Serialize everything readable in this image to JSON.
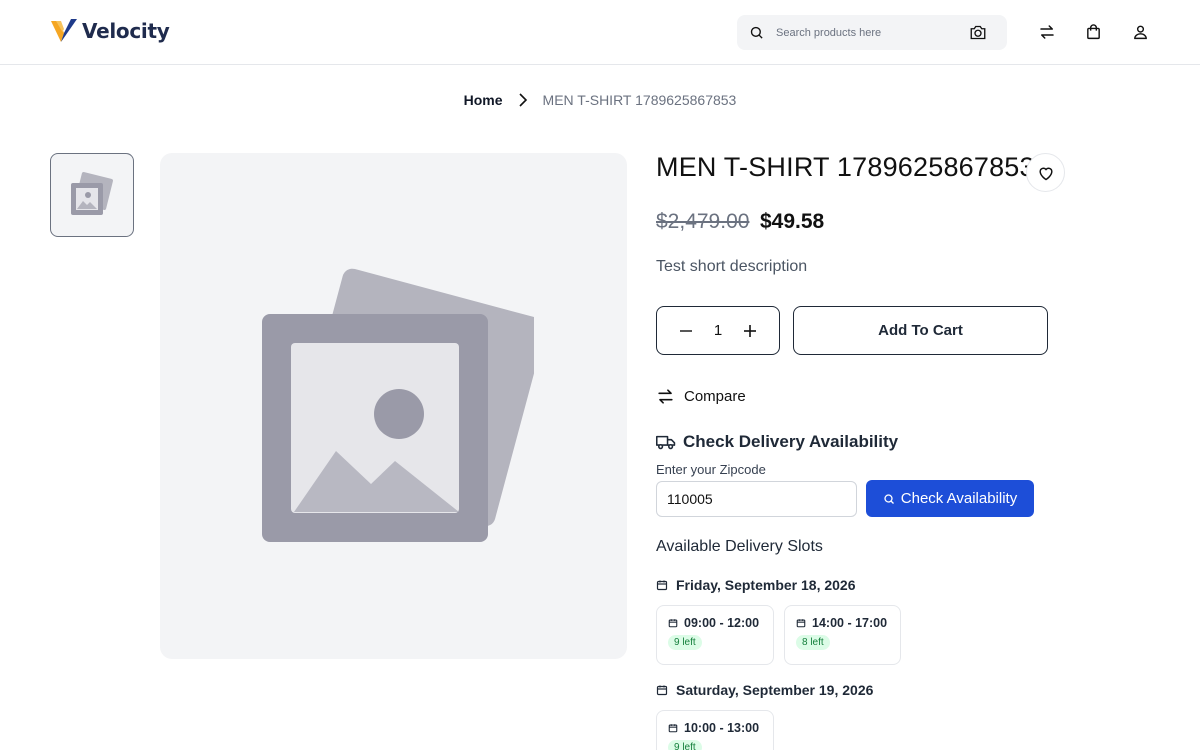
{
  "header": {
    "brand": "Velocity",
    "search_placeholder": "Search products here",
    "icons": [
      "search-icon",
      "camera-icon",
      "compare-icon",
      "shopping-bag-icon",
      "user-icon"
    ]
  },
  "breadcrumb": {
    "home": "Home",
    "current": "MEN T-SHIRT 1789625867853"
  },
  "product": {
    "title": "MEN T-SHIRT 1789625867853",
    "price_old": "$2,479.00",
    "price_new": "$49.58",
    "short_description": "Test short description",
    "quantity": "1",
    "add_to_cart_label": "Add To Cart",
    "compare_label": "Compare"
  },
  "delivery": {
    "heading": "Check Delivery Availability",
    "zip_label": "Enter your Zipcode",
    "zip_value": "110005",
    "check_button": "Check Availability",
    "slots_title": "Available Delivery Slots",
    "days": [
      {
        "date": "Friday, September 18, 2026",
        "slots": [
          {
            "time": "09:00 - 12:00",
            "left": "9 left"
          },
          {
            "time": "14:00 - 17:00",
            "left": "8 left"
          }
        ]
      },
      {
        "date": "Saturday, September 19, 2026",
        "slots": [
          {
            "time": "10:00 - 13:00",
            "left": "9 left"
          }
        ]
      }
    ]
  },
  "colors": {
    "accent_blue": "#1d4ed8",
    "badge_bg": "#dcfce7",
    "badge_text": "#15803d",
    "placeholder_gray": "#9a9aa8"
  }
}
